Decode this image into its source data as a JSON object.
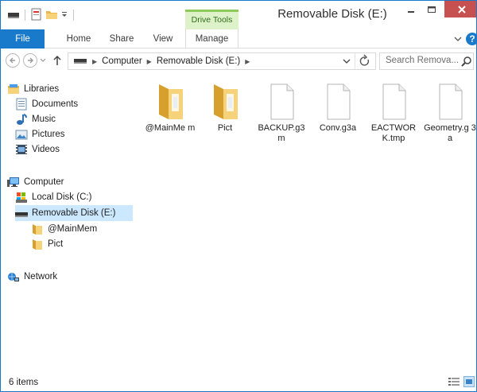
{
  "titlebar": {
    "context_tab_group": "Drive Tools",
    "title": "Removable Disk (E:)"
  },
  "ribbon": {
    "tabs": [
      {
        "label": "File"
      },
      {
        "label": "Home"
      },
      {
        "label": "Share"
      },
      {
        "label": "View"
      },
      {
        "label": "Manage"
      }
    ],
    "help_label": "?"
  },
  "address": {
    "crumbs": [
      "Computer",
      "Removable Disk (E:)"
    ],
    "search_placeholder": "Search Remova..."
  },
  "nav": {
    "items": [
      {
        "label": "Libraries",
        "icon": "libraries-icon"
      },
      {
        "label": "Documents",
        "icon": "documents-icon"
      },
      {
        "label": "Music",
        "icon": "music-icon"
      },
      {
        "label": "Pictures",
        "icon": "pictures-icon"
      },
      {
        "label": "Videos",
        "icon": "videos-icon"
      },
      {
        "label": "Computer",
        "icon": "computer-icon"
      },
      {
        "label": "Local Disk (C:)",
        "icon": "local-disk-icon"
      },
      {
        "label": "Removable Disk (E:)",
        "icon": "removable-disk-icon"
      },
      {
        "label": "@MainMem",
        "icon": "folder-icon"
      },
      {
        "label": "Pict",
        "icon": "folder-icon"
      },
      {
        "label": "Network",
        "icon": "network-icon"
      }
    ],
    "selected": "Removable Disk (E:)"
  },
  "files": [
    {
      "name": "@MainMe m",
      "type": "folder"
    },
    {
      "name": "Pict",
      "type": "folder"
    },
    {
      "name": "BACKUP.g3 m",
      "type": "file"
    },
    {
      "name": "Conv.g3a",
      "type": "file"
    },
    {
      "name": "EACTWOR K.tmp",
      "type": "file"
    },
    {
      "name": "Geometry.g 3a",
      "type": "file"
    }
  ],
  "status": {
    "item_count": "6 items"
  },
  "colors": {
    "accent": "#1979ca",
    "selection": "#cce8ff",
    "close_button": "#c75050",
    "context_tab": "#def2c9"
  }
}
